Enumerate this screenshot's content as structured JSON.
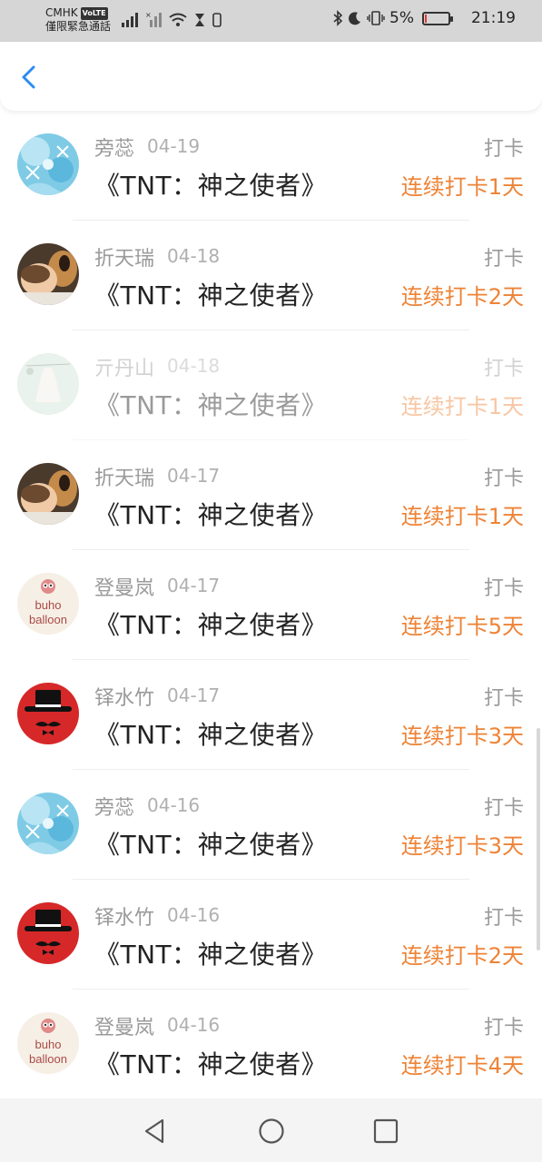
{
  "status_bar": {
    "carrier": "CMHK",
    "volte": "VoLTE",
    "emergency": "僅限緊急通話",
    "battery_percent": "5%",
    "battery_level": 0.05,
    "time": "21:19"
  },
  "colors": {
    "accent": "#2d8cf0",
    "streak": "#ee8336"
  },
  "list": {
    "items": [
      {
        "name": "旁蕊",
        "date": "04-19",
        "action": "打卡",
        "book": "《TNT：神之使者》",
        "streak": "连续打卡1天",
        "avatar": "snowflake-avatar",
        "faded": false
      },
      {
        "name": "折天瑞",
        "date": "04-18",
        "action": "打卡",
        "book": "《TNT：神之使者》",
        "streak": "连续打卡2天",
        "avatar": "baby-dog-avatar",
        "faded": false
      },
      {
        "name": "亓丹山",
        "date": "04-18",
        "action": "打卡",
        "book": "《TNT：神之使者》",
        "streak": "连续打卡1天",
        "avatar": "dress-avatar",
        "faded": true
      },
      {
        "name": "折天瑞",
        "date": "04-17",
        "action": "打卡",
        "book": "《TNT：神之使者》",
        "streak": "连续打卡1天",
        "avatar": "baby-dog-avatar",
        "faded": false
      },
      {
        "name": "登曼岚",
        "date": "04-17",
        "action": "打卡",
        "book": "《TNT：神之使者》",
        "streak": "连续打卡5天",
        "avatar": "owl-balloon-avatar",
        "faded": false
      },
      {
        "name": "铎水竹",
        "date": "04-17",
        "action": "打卡",
        "book": "《TNT：神之使者》",
        "streak": "连续打卡3天",
        "avatar": "hat-mustache-avatar",
        "faded": false
      },
      {
        "name": "旁蕊",
        "date": "04-16",
        "action": "打卡",
        "book": "《TNT：神之使者》",
        "streak": "连续打卡3天",
        "avatar": "snowflake-avatar",
        "faded": false
      },
      {
        "name": "铎水竹",
        "date": "04-16",
        "action": "打卡",
        "book": "《TNT：神之使者》",
        "streak": "连续打卡2天",
        "avatar": "hat-mustache-avatar",
        "faded": false
      },
      {
        "name": "登曼岚",
        "date": "04-16",
        "action": "打卡",
        "book": "《TNT：神之使者》",
        "streak": "连续打卡4天",
        "avatar": "owl-balloon-avatar",
        "faded": false
      }
    ]
  },
  "avatar_text": {
    "balloon_line1": "buho",
    "balloon_line2": "balloon"
  }
}
